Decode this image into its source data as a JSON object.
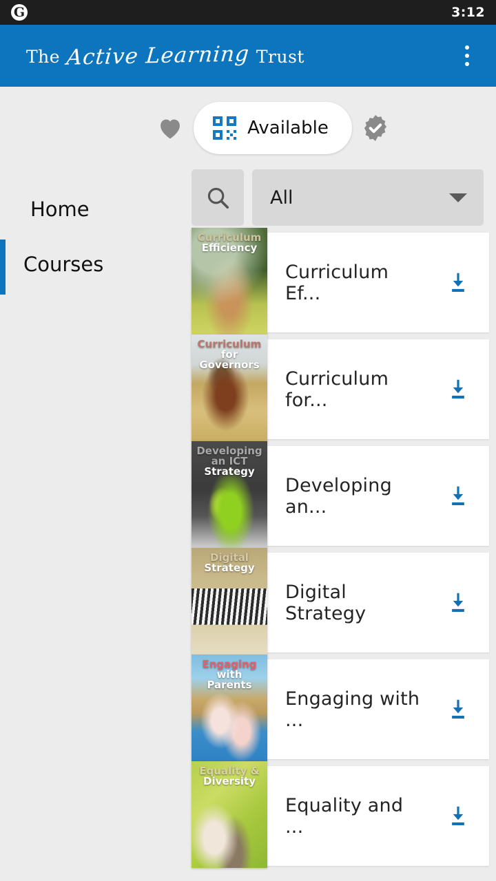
{
  "status_bar": {
    "app_icon": "google-g-icon",
    "time": "3:12"
  },
  "app_bar": {
    "brand_prefix": "The",
    "brand_script": "Active Learning",
    "brand_suffix": "Trust",
    "overflow_icon": "more-vert-icon",
    "background_color": "#0c75be"
  },
  "filters": {
    "favourites_icon": "heart-icon",
    "available": {
      "icon": "qr-code-icon",
      "label": "Available",
      "selected": true
    },
    "completed_icon": "verified-badge-icon",
    "accent_color": "#1678c2"
  },
  "sidebar": {
    "items": [
      {
        "label": "Home",
        "active": false
      },
      {
        "label": "Courses",
        "active": true
      }
    ]
  },
  "search": {
    "search_icon": "search-icon",
    "filter_value": "All",
    "dropdown_icon": "chevron-down-icon"
  },
  "courses": [
    {
      "title": "Curriculum Ef...",
      "thumb_caption_line1": "Curriculum",
      "thumb_caption_line2": "Efficiency",
      "thumb_caption_color1": "#cfc49a",
      "thumb_caption_color2": "#ffffff",
      "thumb_image": "lynx-running-in-meadow",
      "download_icon": "download-icon"
    },
    {
      "title": "Curriculum for...",
      "thumb_caption_line1": "Curriculum",
      "thumb_caption_line2": "for Governors",
      "thumb_caption_color1": "#b9766a",
      "thumb_caption_color2": "#ffffff",
      "thumb_image": "brown-horse-in-field",
      "download_icon": "download-icon"
    },
    {
      "title": "Developing an...",
      "thumb_caption_line1": "Developing an ICT",
      "thumb_caption_line2": "Strategy",
      "thumb_caption_color1": "#a8a8a8",
      "thumb_caption_color2": "#ffffff",
      "thumb_image": "green-lizard-on-rock",
      "download_icon": "download-icon"
    },
    {
      "title": "Digital Strategy",
      "thumb_caption_line1": "Digital",
      "thumb_caption_line2": "Strategy",
      "thumb_caption_color1": "#d6c9a6",
      "thumb_caption_color2": "#ffffff",
      "thumb_image": "herd-of-zebras-on-savanna",
      "download_icon": "download-icon"
    },
    {
      "title": "Engaging with ...",
      "thumb_caption_line1": "Engaging",
      "thumb_caption_line2": "with Parents",
      "thumb_caption_color1": "#e2616d",
      "thumb_caption_color2": "#ffffff",
      "thumb_image": "two-flamingos-in-water",
      "download_icon": "download-icon"
    },
    {
      "title": "Equality and ...",
      "thumb_caption_line1": "Equality &",
      "thumb_caption_line2": "Diversity",
      "thumb_caption_color1": "#d9d2a6",
      "thumb_caption_color2": "#ffffff",
      "thumb_image": "puppy-and-kitten-on-green",
      "download_icon": "download-icon"
    }
  ]
}
